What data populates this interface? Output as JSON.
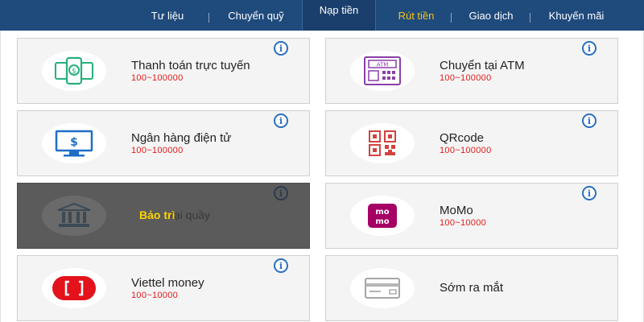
{
  "nav": {
    "items": [
      {
        "label": "Tư liệu"
      },
      {
        "label": "Chuyển quỹ"
      },
      {
        "label": "Nạp tiền"
      },
      {
        "label": "Rút tiền"
      },
      {
        "label": "Giao dịch"
      },
      {
        "label": "Khuyến mãi"
      }
    ],
    "active": "Nạp tiền"
  },
  "cards": [
    {
      "title": "Thanh toán trực tuyến",
      "range": "100~100000",
      "icon": "online-payment-icon"
    },
    {
      "title": "Chuyển tại ATM",
      "range": "100~100000",
      "icon": "atm-icon"
    },
    {
      "title": "Ngân hàng điện tử",
      "range": "100~100000",
      "icon": "e-banking-icon"
    },
    {
      "title": "QRcode",
      "range": "100~100000",
      "icon": "qrcode-icon"
    },
    {
      "title": "tại quầy",
      "status": "Bảo trì",
      "icon": "bank-counter-icon"
    },
    {
      "title": "MoMo",
      "range": "100~10000",
      "icon": "momo-icon"
    },
    {
      "title": "Viettel money",
      "range": "100~10000",
      "icon": "viettel-money-icon"
    },
    {
      "title": "Sớm ra mắt",
      "icon": "card-icon"
    }
  ],
  "info_symbol": "i",
  "colors": {
    "nav_bg": "#1f4a7c",
    "nav_active": "#f5c518",
    "range_text": "#e01b1b",
    "info_blue": "#2a6fc0",
    "maintenance_bg": "#5b5b5b",
    "maintenance_label": "#ffd400"
  }
}
